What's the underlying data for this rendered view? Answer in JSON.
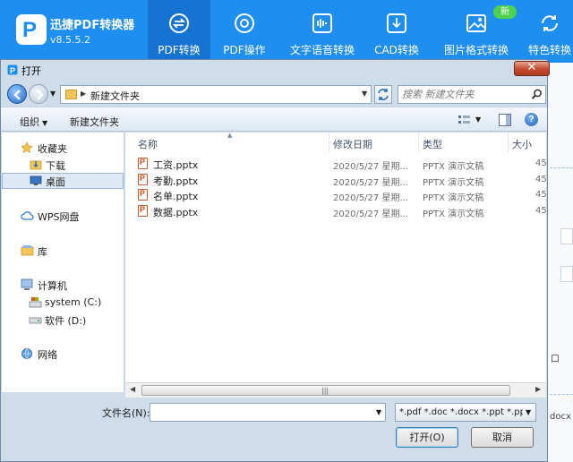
{
  "app": {
    "name": "迅捷PDF转换器",
    "version": "v8.5.5.2",
    "nav": [
      {
        "label": "PDF转换",
        "icon": "convert-icon",
        "active": true
      },
      {
        "label": "PDF操作",
        "icon": "gear-icon",
        "active": false
      },
      {
        "label": "文字语音转换",
        "icon": "audio-wave-icon",
        "active": false
      },
      {
        "label": "CAD转换",
        "icon": "cad-icon",
        "active": false
      },
      {
        "label": "图片格式转换",
        "icon": "image-icon",
        "active": false
      },
      {
        "label": "特色转换",
        "icon": "refresh-icon",
        "active": false
      }
    ],
    "badge": "新",
    "side_fragments": [
      "口",
      "docx"
    ],
    "accent_color": "#1f8ef1"
  },
  "dialog": {
    "title": "打开",
    "breadcrumb": "新建文件夹",
    "search_placeholder": "搜索 新建文件夹",
    "toolbar": {
      "organize": "组织",
      "new_folder": "新建文件夹"
    },
    "tree": [
      {
        "label": "收藏夹",
        "icon": "star-icon"
      },
      {
        "label": "下载",
        "icon": "download-folder-icon"
      },
      {
        "label": "桌面",
        "icon": "desktop-icon",
        "selected": true
      },
      {
        "label": "WPS网盘",
        "icon": "cloud-icon"
      },
      {
        "label": "库",
        "icon": "library-icon"
      },
      {
        "label": "计算机",
        "icon": "computer-icon"
      },
      {
        "label": "system (C:)",
        "icon": "drive-c-icon"
      },
      {
        "label": "软件 (D:)",
        "icon": "drive-d-icon"
      },
      {
        "label": "网络",
        "icon": "network-icon"
      }
    ],
    "columns": [
      "名称",
      "修改日期",
      "类型",
      "大小"
    ],
    "files": [
      {
        "name": "工资.pptx",
        "date": "2020/5/27 星期...",
        "type": "PPTX 演示文稿",
        "size": "45"
      },
      {
        "name": "考勤.pptx",
        "date": "2020/5/27 星期...",
        "type": "PPTX 演示文稿",
        "size": "45"
      },
      {
        "name": "名单.pptx",
        "date": "2020/5/27 星期...",
        "type": "PPTX 演示文稿",
        "size": "45"
      },
      {
        "name": "数据.pptx",
        "date": "2020/5/27 星期...",
        "type": "PPTX 演示文稿",
        "size": "45"
      }
    ],
    "filename_label": "文件名(N):",
    "filename_value": "",
    "filter": "*.pdf *.doc *.docx *.ppt *.ppt",
    "open_button": "打开(O)",
    "cancel_button": "取消"
  }
}
